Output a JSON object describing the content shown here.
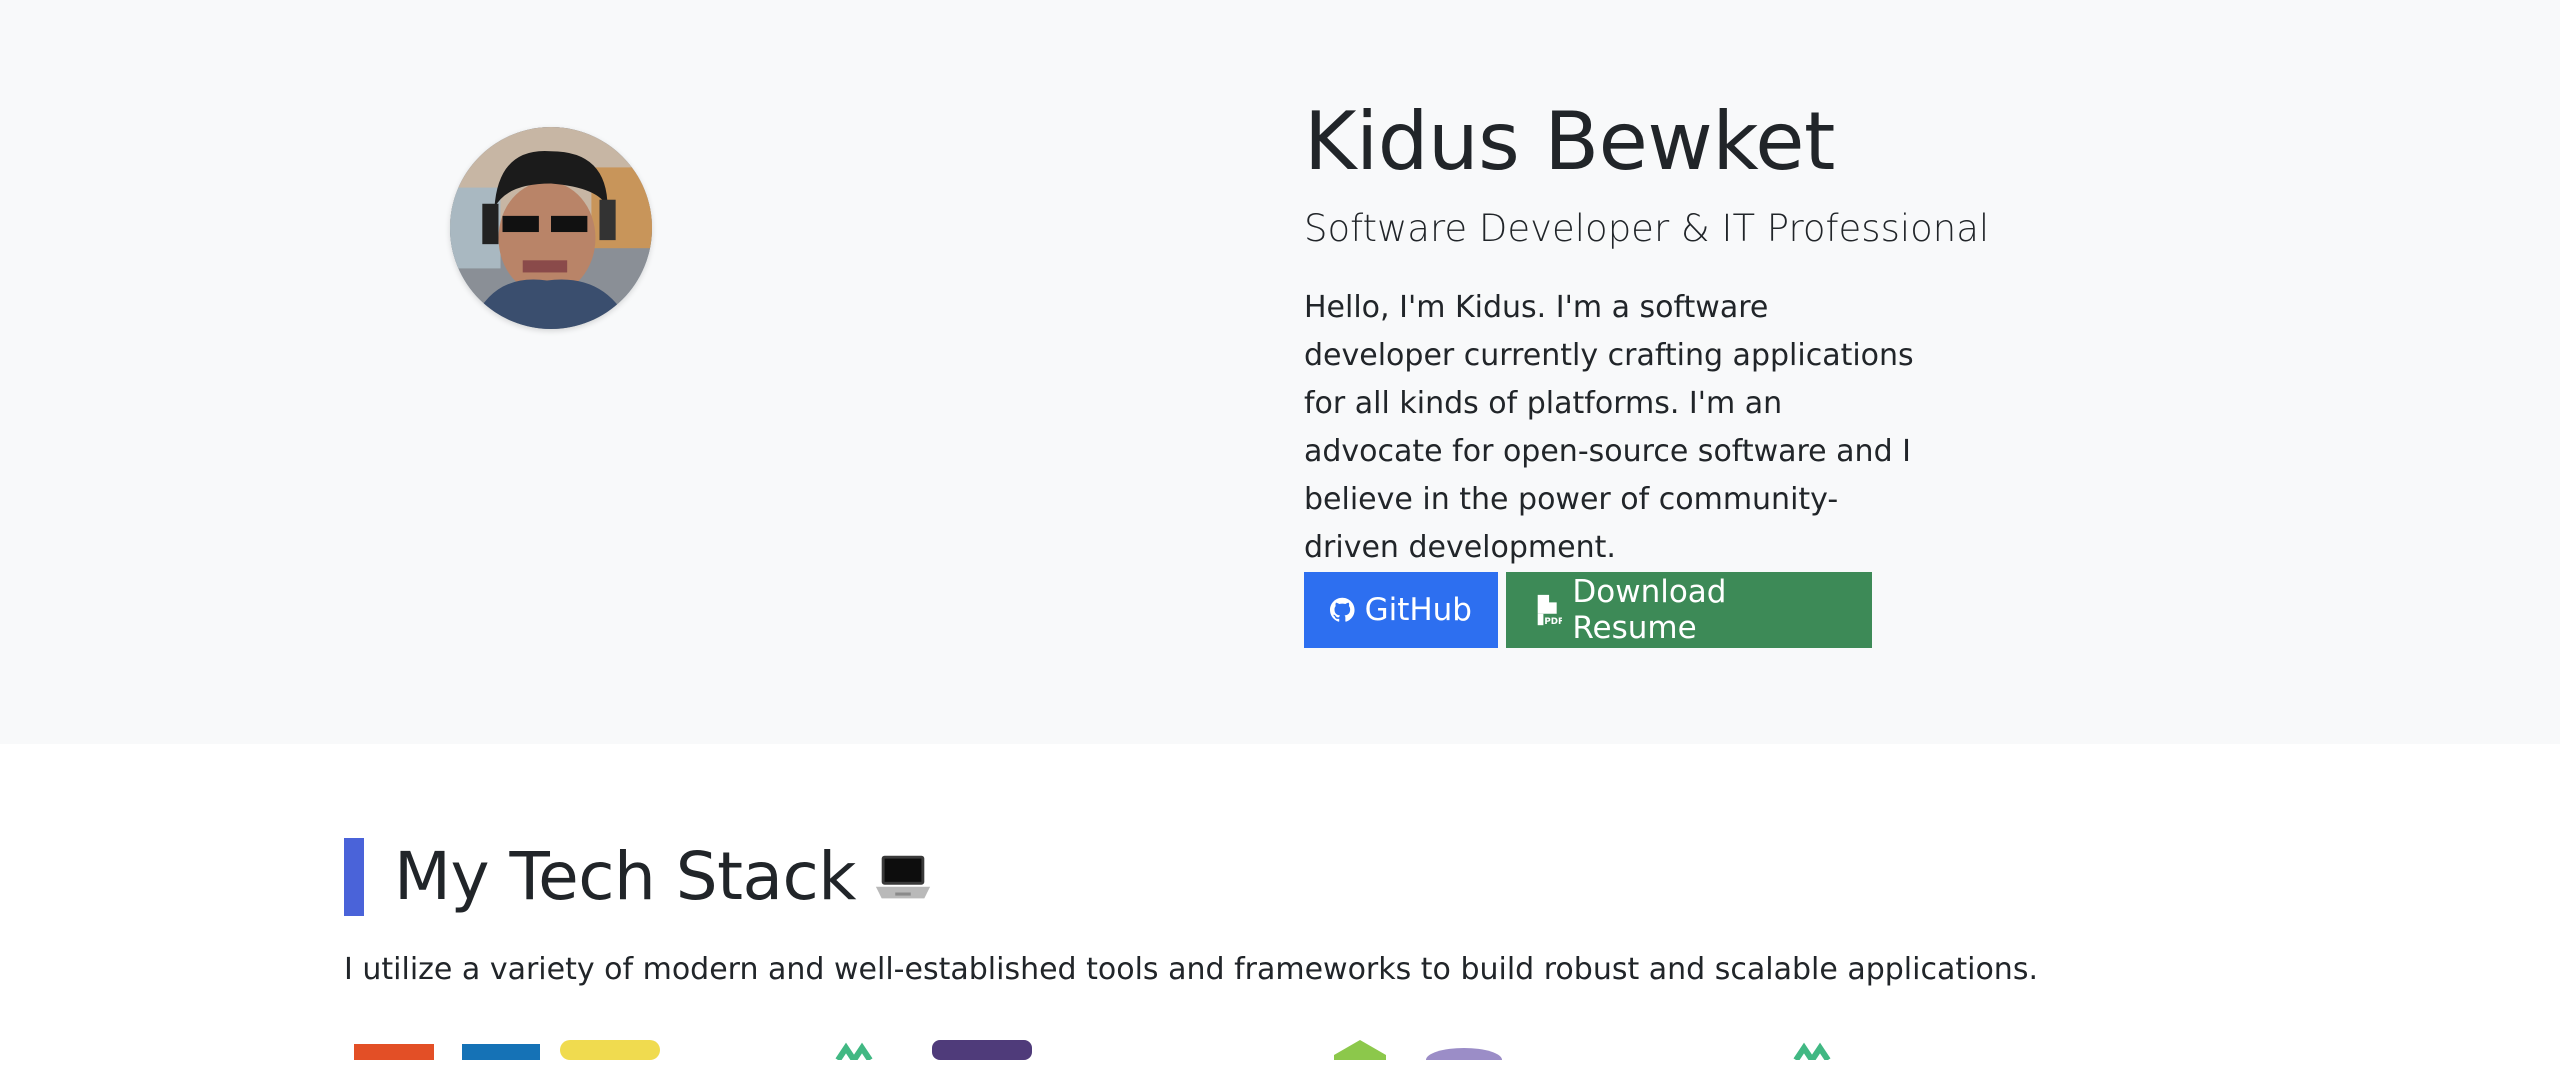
{
  "profile": {
    "name": "Kidus Bewket",
    "role": "Software Developer & IT Professional",
    "bio": "Hello, I'm Kidus. I'm a software developer currently crafting applications for all kinds of platforms. I'm an advocate for open-source software and I believe in the power of community-driven development.",
    "avatar_icon": "user-avatar-photo"
  },
  "buttons": {
    "github_label": "GitHub",
    "github_icon": "github-icon",
    "resume_label": "Download Resume",
    "resume_icon": "pdf-file-icon"
  },
  "tech_stack": {
    "title": "My Tech Stack",
    "title_icon": "laptop-icon",
    "description": "I utilize a variety of modern and well-established tools and frameworks to build robust and scalable applications."
  },
  "colors": {
    "hero_background": "#f8f9fa",
    "github_button": "#2d6ff0",
    "resume_button": "#3d8a57",
    "section_accent": "#4a63d9"
  }
}
